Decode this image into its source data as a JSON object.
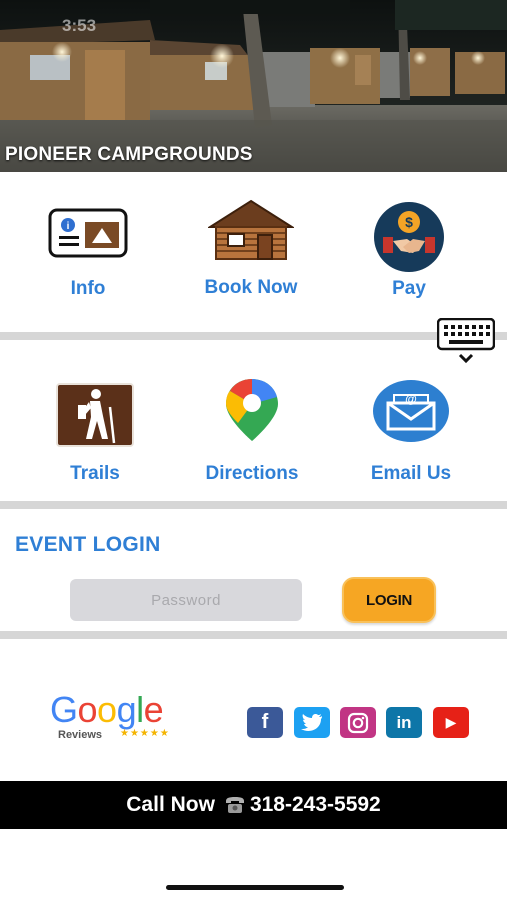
{
  "status_bar": {
    "time": "3:53"
  },
  "hero": {
    "title": "PIONEER CAMPGROUNDS"
  },
  "tiles_row1": [
    {
      "label": "Info",
      "icon": "id-card-icon"
    },
    {
      "label": "Book Now",
      "icon": "log-cabin-icon"
    },
    {
      "label": "Pay",
      "icon": "dollar-handshake-icon"
    }
  ],
  "tiles_row2": [
    {
      "label": "Trails",
      "icon": "hiker-icon"
    },
    {
      "label": "Directions",
      "icon": "map-pin-icon"
    },
    {
      "label": "Email Us",
      "icon": "envelope-icon"
    }
  ],
  "event_login": {
    "title": "EVENT LOGIN",
    "password_placeholder": "Password",
    "login_label": "LOGIN"
  },
  "google": {
    "word": "Google",
    "sub": "Reviews",
    "stars": "★★★★★"
  },
  "social": [
    {
      "name": "facebook",
      "glyph": "f",
      "color": "#3b5998"
    },
    {
      "name": "twitter",
      "glyph": "t",
      "color": "#1da1f2"
    },
    {
      "name": "instagram",
      "glyph": "ig",
      "color": "#c13584"
    },
    {
      "name": "linkedin",
      "glyph": "in",
      "color": "#0e76a8"
    },
    {
      "name": "youtube",
      "glyph": "▶",
      "color": "#e62117"
    }
  ],
  "call": {
    "prefix": "Call Now",
    "phone": "318-243-5592"
  },
  "colors": {
    "accent_blue": "#2f7fd5",
    "login_orange": "#f6a623",
    "divider": "#d6d6d6"
  }
}
